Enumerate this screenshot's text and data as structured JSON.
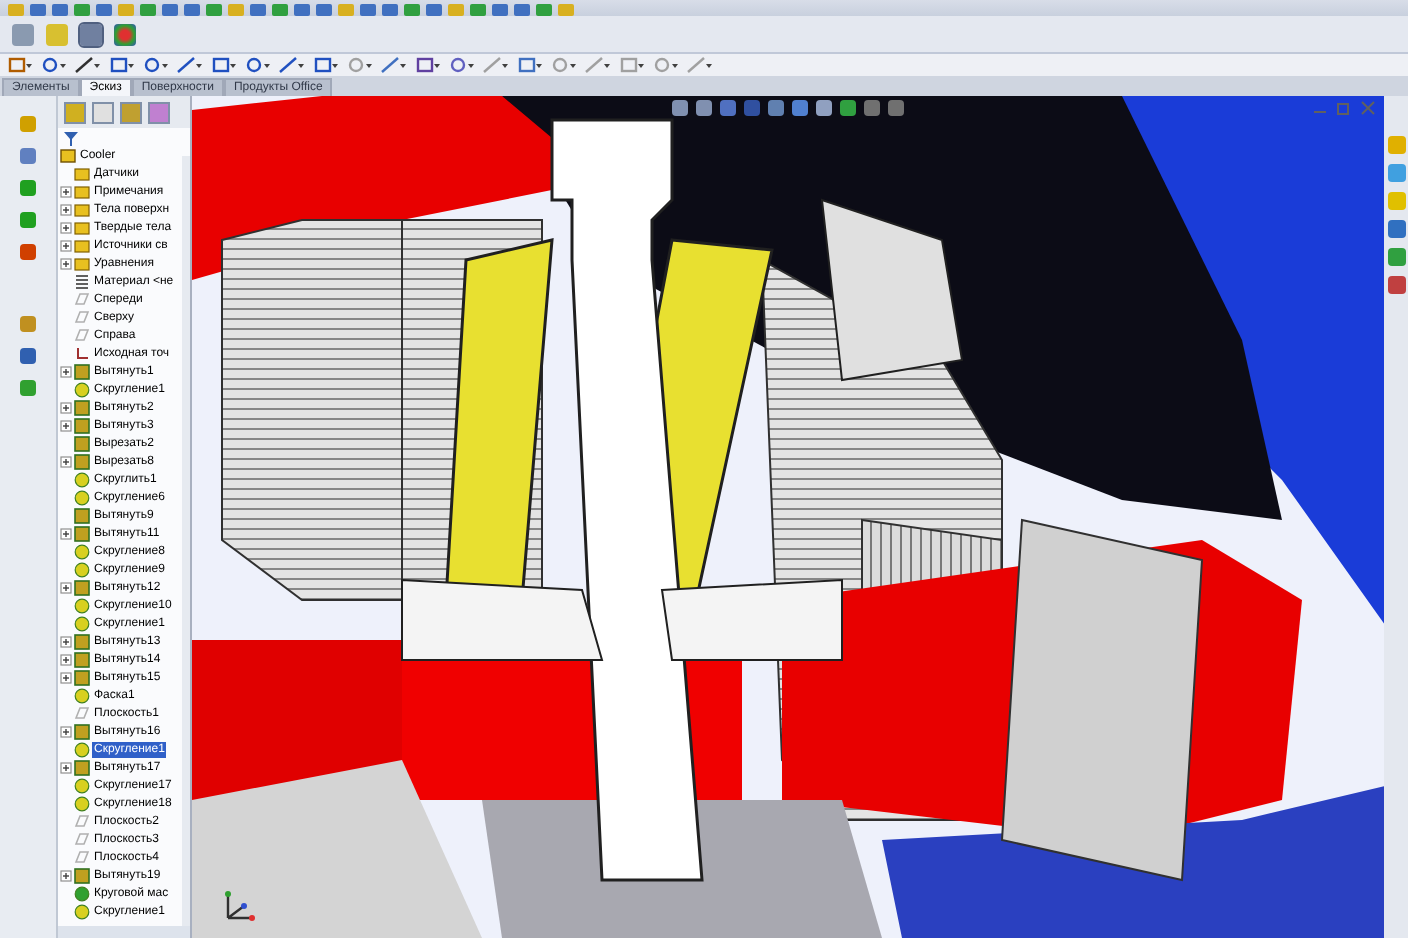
{
  "tabs": [
    {
      "label": "Элементы",
      "selected": false
    },
    {
      "label": "Эскиз",
      "selected": true
    },
    {
      "label": "Поверхности",
      "selected": false
    },
    {
      "label": "Продукты Office",
      "selected": false
    }
  ],
  "tree": {
    "root": "Cooler",
    "items": [
      {
        "label": "Датчики",
        "kind": "folder",
        "selected": false
      },
      {
        "label": "Примечания",
        "kind": "note",
        "expanded": false,
        "selected": false
      },
      {
        "label": "Тела поверхн",
        "kind": "folder",
        "expanded": false,
        "selected": false
      },
      {
        "label": "Твердые тела",
        "kind": "folder",
        "expanded": false,
        "selected": false
      },
      {
        "label": "Источники св",
        "kind": "folder",
        "expanded": false,
        "selected": false
      },
      {
        "label": "Уравнения",
        "kind": "folder",
        "expanded": false,
        "selected": false
      },
      {
        "label": "Материал <не",
        "kind": "material",
        "selected": false
      },
      {
        "label": "Спереди",
        "kind": "plane",
        "selected": false
      },
      {
        "label": "Сверху",
        "kind": "plane",
        "selected": false
      },
      {
        "label": "Справа",
        "kind": "plane",
        "selected": false
      },
      {
        "label": "Исходная точ",
        "kind": "origin",
        "selected": false
      },
      {
        "label": "Вытянуть1",
        "kind": "extrude",
        "expanded": false,
        "selected": false
      },
      {
        "label": "Скругление1",
        "kind": "fillet",
        "selected": false
      },
      {
        "label": "Вытянуть2",
        "kind": "extrude",
        "expanded": false,
        "selected": false
      },
      {
        "label": "Вытянуть3",
        "kind": "extrude",
        "expanded": false,
        "selected": false
      },
      {
        "label": "Вырезать2",
        "kind": "extrude",
        "selected": false
      },
      {
        "label": "Вырезать8",
        "kind": "extrude",
        "expanded": false,
        "selected": false
      },
      {
        "label": "Скруглить1",
        "kind": "fillet",
        "selected": false
      },
      {
        "label": "Скругление6",
        "kind": "fillet",
        "selected": false
      },
      {
        "label": "Вытянуть9",
        "kind": "extrude",
        "selected": false
      },
      {
        "label": "Вытянуть11",
        "kind": "extrude",
        "expanded": false,
        "selected": false
      },
      {
        "label": "Скругление8",
        "kind": "fillet",
        "selected": false
      },
      {
        "label": "Скругление9",
        "kind": "fillet",
        "selected": false
      },
      {
        "label": "Вытянуть12",
        "kind": "extrude",
        "expanded": false,
        "selected": false
      },
      {
        "label": "Скругление10",
        "kind": "fillet",
        "selected": false
      },
      {
        "label": "Скругление1",
        "kind": "fillet",
        "selected": false
      },
      {
        "label": "Вытянуть13",
        "kind": "extrude",
        "expanded": false,
        "selected": false
      },
      {
        "label": "Вытянуть14",
        "kind": "extrude",
        "expanded": false,
        "selected": false
      },
      {
        "label": "Вытянуть15",
        "kind": "extrude",
        "expanded": false,
        "selected": false
      },
      {
        "label": "Фаска1",
        "kind": "fillet",
        "selected": false
      },
      {
        "label": "Плоскость1",
        "kind": "plane",
        "selected": false
      },
      {
        "label": "Вытянуть16",
        "kind": "extrude",
        "expanded": false,
        "selected": false
      },
      {
        "label": "Скругление1",
        "kind": "fillet",
        "selected": true
      },
      {
        "label": "Вытянуть17",
        "kind": "extrude",
        "expanded": false,
        "selected": false
      },
      {
        "label": "Скругление17",
        "kind": "fillet",
        "selected": false
      },
      {
        "label": "Скругление18",
        "kind": "fillet",
        "selected": false
      },
      {
        "label": "Плоскость2",
        "kind": "plane",
        "selected": false
      },
      {
        "label": "Плоскость3",
        "kind": "plane",
        "selected": false
      },
      {
        "label": "Плоскость4",
        "kind": "plane",
        "selected": false
      },
      {
        "label": "Вытянуть19",
        "kind": "extrude",
        "expanded": false,
        "selected": false
      },
      {
        "label": "Круговой мас",
        "kind": "pattern",
        "selected": false
      },
      {
        "label": "Скругление1",
        "kind": "fillet",
        "selected": false
      }
    ]
  }
}
